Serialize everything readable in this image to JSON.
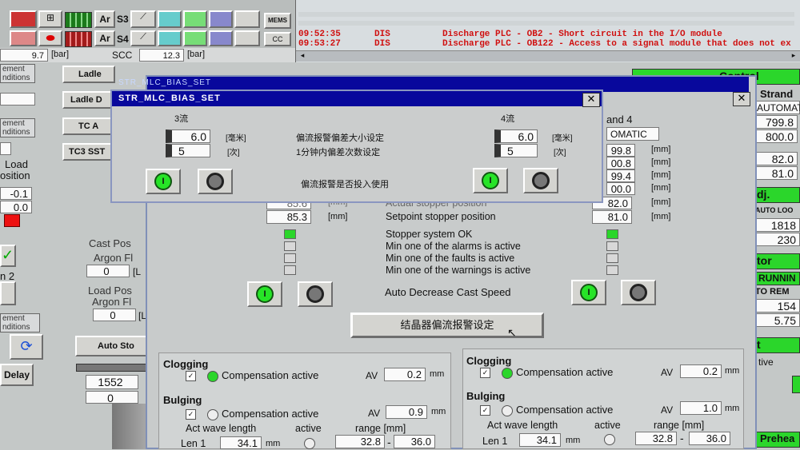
{
  "toolbar": {
    "ar1": "Ar",
    "s3": "S3",
    "ar2": "Ar",
    "s4": "S4",
    "mems": "MEMS",
    "cc": "CC"
  },
  "pressure": {
    "val1": "9.7",
    "unit1": "[bar]",
    "scc_label": "SCC",
    "val2": "12.3",
    "unit2": "[bar]"
  },
  "messages": [
    {
      "time": "09:52:35",
      "src": "DIS",
      "text": "Discharge PLC - OB2 - Short circuit in the I/O module"
    },
    {
      "time": "09:53:27",
      "src": "DIS",
      "text": "Discharge PLC - OB122 - Access to a signal module that does not ex"
    }
  ],
  "left": {
    "ement1": "ement",
    "ditions1": "nditions",
    "ement2": "ement",
    "ditions2": "nditions",
    "load": "Load",
    "osition": "osition",
    "val_a": "-0.1",
    "val_b": "0.0",
    "n2": "n 2",
    "ement3": "ement",
    "ditions3": "nditions",
    "delay": "Delay",
    "ladle1": "Ladle",
    "ladle2": "Ladle D",
    "tc": "TC  A",
    "tc3": "TC3 SST",
    "cast_pos": "Cast Pos",
    "argon1": "Argon Fl",
    "val0a": "0",
    "la": "[L",
    "load_pos": "Load Pos",
    "argon2": "Argon Fl",
    "val0b": "0",
    "lb": "[L",
    "auto_sto": "Auto  Sto",
    "val1552": "1552",
    "val0c": "0"
  },
  "right_panel": {
    "control": "Control",
    "strand": "Strand",
    "automat": "AUTOMAT",
    "v1": "799.8",
    "v2": "800.0",
    "v3": "82.0",
    "v4": "81.0",
    "adj": "dj.",
    "auto_loo": "AUTO LOO",
    "v5": "1818",
    "v6": "230",
    "tor": "tor",
    "running": "RUNNIN",
    "auto_rem": "TO REM",
    "v7": "154",
    "v8": "5.75",
    "tive": "tive",
    "t": "t",
    "prehea": "Prehea"
  },
  "back_dialog": {
    "stand4": "and 4",
    "automatic": "OMATIC",
    "rows": [
      {
        "val": "99.8",
        "unit": "[mm]"
      },
      {
        "val": "00.8",
        "unit": "[mm]"
      },
      {
        "val": "99.4",
        "unit": "[mm]"
      },
      {
        "val": "00.0",
        "unit": "[mm]"
      }
    ],
    "actual_label": "Actual stopper position",
    "setpoint_label": "Setpoint stopper position",
    "left_actual": "85.6",
    "left_setpoint": "85.3",
    "mm": "[mm]",
    "right_actual": "82.0",
    "right_setpoint": "81.0",
    "status": [
      "Stopper system OK",
      "Min one of the alarms is active",
      "Min one of the faults is active",
      "Min one of the warnings is active"
    ],
    "auto_decrease": "Auto Decrease Cast Speed",
    "mould_btn": "结晶器偏流报警设定",
    "left_col": {
      "clogging": "Clogging",
      "comp_active": "Compensation active",
      "av": "AV",
      "clog_av": "0.2",
      "mm": "mm",
      "bulging": "Bulging",
      "bulg_av": "0.9",
      "act_wave": "Act wave length",
      "active": "active",
      "range": "range [mm]",
      "len1": "Len 1",
      "len1_val": "34.1",
      "range_lo": "32.8",
      "dash": "-",
      "range_hi": "36.0"
    },
    "right_col": {
      "clogging": "Clogging",
      "comp_active": "Compensation active",
      "av": "AV",
      "clog_av": "0.2",
      "mm": "mm",
      "bulging": "Bulging",
      "bulg_av": "1.0",
      "act_wave": "Act wave length",
      "active": "active",
      "range": "range [mm]",
      "len1": "Len 1",
      "len1_val": "34.1",
      "range_lo": "32.8",
      "dash": "-",
      "range_hi": "36.0"
    }
  },
  "bias_dialog": {
    "behind_title": "STR_MLC_BIAS_SET",
    "title": "STR_MLC_BIAS_SET",
    "close": "✕",
    "strand3": "3流",
    "strand4": "4流",
    "left_dev": "6.0",
    "left_dev_unit": "[毫米]",
    "dev_label": "偏流报警偏差大小设定",
    "right_dev": "6.0",
    "right_dev_unit": "[毫米]",
    "left_cnt": "5",
    "left_cnt_unit": "[次]",
    "cnt_label": "1分钟内偏差次数设定",
    "right_cnt": "5",
    "right_cnt_unit": "[次]",
    "enable_label": "偏流报警是否投入使用",
    "on_glyph": "I"
  },
  "colors": {
    "title_blue": "#08089c",
    "msg_red": "#d01010",
    "status_green": "#2ad62a",
    "panel_gray": "#c4c8c7"
  }
}
